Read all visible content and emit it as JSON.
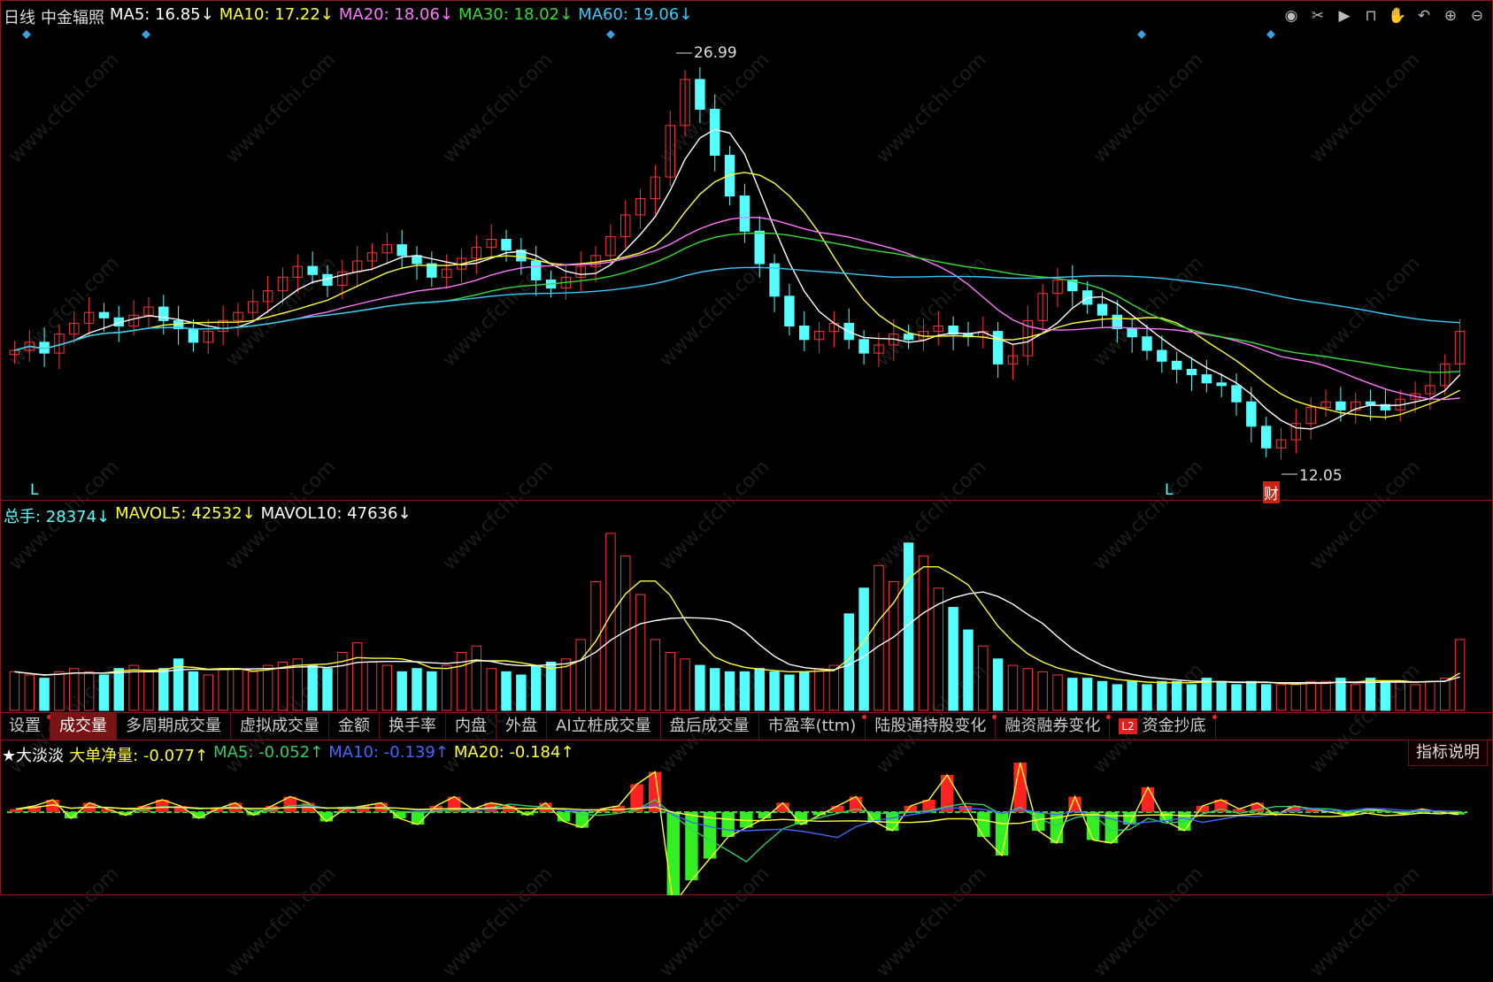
{
  "main_chart": {
    "period_label": "日线",
    "stock_name": "中金辐照",
    "ma": [
      {
        "label": "MA5: 16.85↓",
        "color": "#ffffff"
      },
      {
        "label": "MA10: 17.22↓",
        "color": "#ffff33"
      },
      {
        "label": "MA20: 18.06↓",
        "color": "#ff77ff"
      },
      {
        "label": "MA30: 18.02↓",
        "color": "#33dd33"
      },
      {
        "label": "MA60: 19.06↓",
        "color": "#33ccff"
      }
    ],
    "high_label": "26.99",
    "low_label": "12.05",
    "marker_l1": "L",
    "marker_l2": "L",
    "marker_cai": "财"
  },
  "volume_panel": {
    "total": "总手: 28374↓",
    "mavol5": "MAVOL5: 42532↓",
    "mavol10": "MAVOL10: 47636↓"
  },
  "tabs": [
    {
      "label": "设置",
      "dot": true
    },
    {
      "label": "成交量",
      "active": true
    },
    {
      "label": "多周期成交量"
    },
    {
      "label": "虚拟成交量"
    },
    {
      "label": "金额"
    },
    {
      "label": "换手率"
    },
    {
      "label": "内盘"
    },
    {
      "label": "外盘"
    },
    {
      "label": "AI立桩成交量"
    },
    {
      "label": "盘后成交量"
    },
    {
      "label": "市盈率(ttm)",
      "dot": true
    },
    {
      "label": "陆股通持股变化",
      "dot": true
    },
    {
      "label": "融资融券变化",
      "dot": true
    },
    {
      "label": "资金抄底",
      "badge": "L2",
      "dot": true
    }
  ],
  "indicator_panel": {
    "name": "★大淡淡",
    "big_order": "大单净量: -0.077↑",
    "ma5": "MA5: -0.052↑",
    "ma10": "MA10: -0.139↑",
    "ma20": "MA20: -0.184↑",
    "explain_button": "指标说明"
  },
  "toolbar": [
    "eye-icon",
    "scissors-icon",
    "play-icon",
    "lock-icon",
    "hand-icon",
    "undo-icon",
    "zoom-in-icon",
    "zoom-out-icon"
  ],
  "watermark": "www.cfchi.com",
  "colors": {
    "up": "#ff3333",
    "down": "#55ffff",
    "ma5": "#ffffff",
    "ma10": "#ffff33",
    "ma20": "#ff77ff",
    "ma30": "#33dd33",
    "ma60": "#33ccff"
  },
  "chart_data": {
    "type": "candlestick",
    "high": 26.99,
    "low": 12.05,
    "close_series": [
      16.2,
      16.5,
      16.1,
      16.8,
      17.2,
      17.6,
      17.4,
      17.1,
      17.5,
      17.8,
      17.3,
      17.0,
      16.5,
      16.9,
      17.3,
      17.6,
      18.0,
      18.4,
      18.9,
      19.3,
      19.0,
      18.6,
      19.1,
      19.5,
      19.8,
      20.1,
      19.7,
      19.4,
      18.9,
      19.2,
      19.6,
      20.0,
      20.3,
      19.9,
      19.5,
      18.8,
      18.5,
      18.9,
      19.3,
      19.7,
      20.4,
      21.2,
      21.8,
      22.6,
      24.5,
      26.2,
      25.1,
      23.4,
      21.9,
      20.6,
      19.4,
      18.2,
      17.1,
      16.6,
      16.9,
      17.2,
      16.6,
      16.1,
      16.4,
      16.8,
      16.6,
      16.9,
      17.1,
      16.8,
      16.7,
      16.9,
      15.7,
      16.0,
      17.3,
      18.3,
      18.8,
      18.4,
      17.9,
      17.5,
      17.0,
      16.7,
      16.2,
      15.8,
      15.5,
      15.3,
      15.0,
      14.9,
      14.3,
      13.4,
      12.6,
      12.9,
      13.5,
      14.1,
      14.3,
      14.0,
      14.3,
      14.2,
      14.0,
      14.4,
      14.6,
      14.9,
      15.7,
      16.9
    ],
    "volume_series": [
      12,
      11,
      10,
      12,
      13,
      12,
      11,
      13,
      14,
      12,
      13,
      16,
      12,
      11,
      13,
      13,
      12,
      14,
      15,
      16,
      14,
      13,
      18,
      21,
      15,
      14,
      12,
      13,
      12,
      14,
      18,
      20,
      13,
      12,
      11,
      14,
      15,
      16,
      22,
      40,
      55,
      48,
      36,
      22,
      18,
      16,
      14,
      13,
      12,
      12,
      13,
      12,
      11,
      12,
      13,
      14,
      30,
      38,
      45,
      40,
      52,
      48,
      38,
      32,
      25,
      20,
      16,
      14,
      13,
      12,
      11,
      10,
      10,
      9,
      8,
      9,
      8,
      9,
      9,
      8,
      10,
      9,
      8,
      9,
      8,
      8,
      8,
      9,
      9,
      10,
      8,
      10,
      9,
      9,
      8,
      9,
      10,
      22
    ],
    "big_order_series": [
      0.1,
      0.2,
      0.4,
      -0.2,
      0.3,
      0.1,
      -0.1,
      0.2,
      0.4,
      0.2,
      -0.2,
      0.1,
      0.3,
      -0.1,
      0.2,
      0.5,
      0.3,
      -0.3,
      0.1,
      0.2,
      0.3,
      -0.2,
      -0.4,
      0.2,
      0.5,
      0.1,
      0.3,
      0.2,
      -0.1,
      0.3,
      -0.3,
      -0.5,
      0.1,
      0.2,
      0.9,
      1.3,
      -3.0,
      -2.2,
      -1.5,
      -0.8,
      -0.5,
      -0.2,
      0.3,
      -0.4,
      -0.1,
      0.2,
      0.5,
      -0.3,
      -0.6,
      0.2,
      0.4,
      1.2,
      0.2,
      -0.8,
      -1.4,
      1.6,
      -0.6,
      -1.0,
      0.5,
      -0.9,
      -1.0,
      -0.4,
      0.8,
      -0.3,
      -0.6,
      0.2,
      0.4,
      0.1,
      0.3,
      -0.1,
      0.2,
      0.1,
      0.0,
      -0.1,
      0.1,
      0.05,
      -0.05,
      0.1,
      0.0,
      -0.08
    ]
  }
}
